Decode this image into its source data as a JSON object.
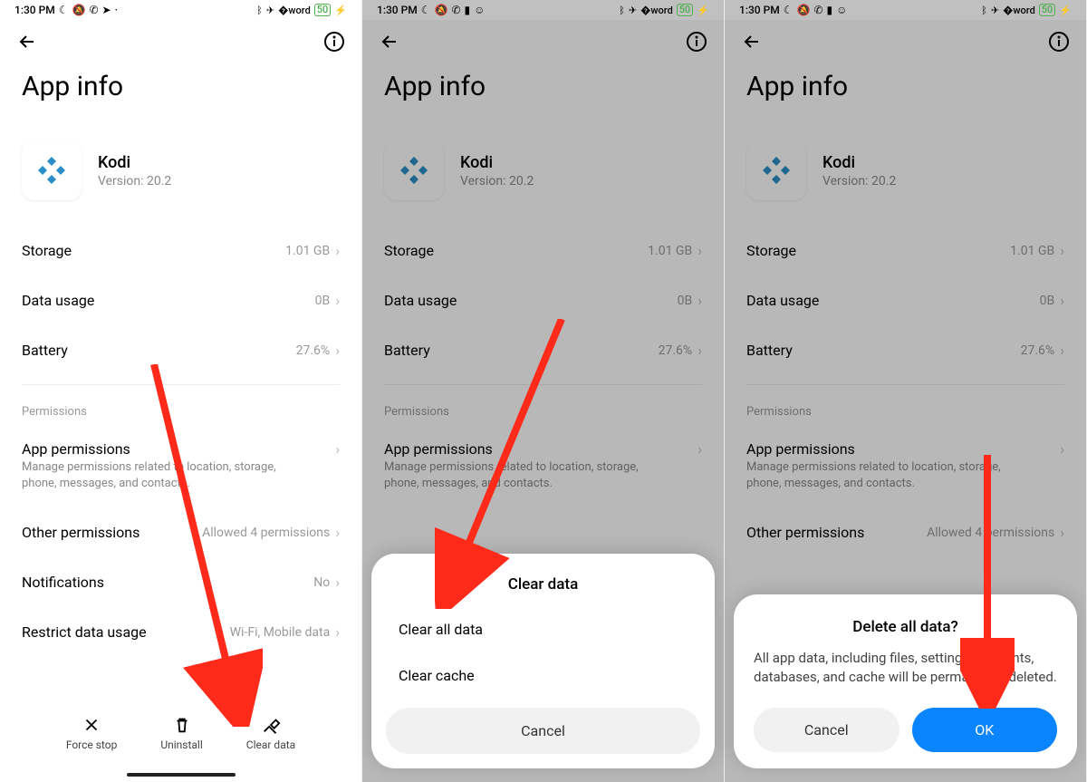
{
  "status_bar": {
    "time": "1:30 PM",
    "icons_left": [
      "moon",
      "dnd",
      "whatsapp",
      "telegram",
      "more"
    ],
    "icons_right": [
      "bluetooth",
      "airplane",
      "wifi",
      "battery-50",
      "charging"
    ],
    "battery_text": "50"
  },
  "page": {
    "title": "App info"
  },
  "app": {
    "name": "Kodi",
    "version_label": "Version: 20.2"
  },
  "rows": {
    "storage": {
      "label": "Storage",
      "value": "1.01 GB"
    },
    "data_usage": {
      "label": "Data usage",
      "value": "0B"
    },
    "battery": {
      "label": "Battery",
      "value": "27.6%"
    }
  },
  "permissions": {
    "header": "Permissions",
    "app_perms": {
      "label": "App permissions",
      "sub": "Manage permissions related to location, storage, phone, messages, and contacts."
    },
    "other": {
      "label": "Other permissions",
      "value": "Allowed 4 permissions"
    },
    "notifications": {
      "label": "Notifications",
      "value": "No"
    },
    "restrict": {
      "label": "Restrict data usage",
      "value": "Wi-Fi, Mobile data"
    }
  },
  "bottom_actions": {
    "force_stop": "Force stop",
    "uninstall": "Uninstall",
    "clear_data": "Clear data"
  },
  "sheet": {
    "title": "Clear data",
    "item1": "Clear all data",
    "item2": "Clear cache",
    "cancel": "Cancel"
  },
  "dialog": {
    "title": "Delete all data?",
    "message": "All app data, including files, settings, accounts, databases, and cache will be permanently deleted.",
    "cancel": "Cancel",
    "ok": "OK"
  }
}
